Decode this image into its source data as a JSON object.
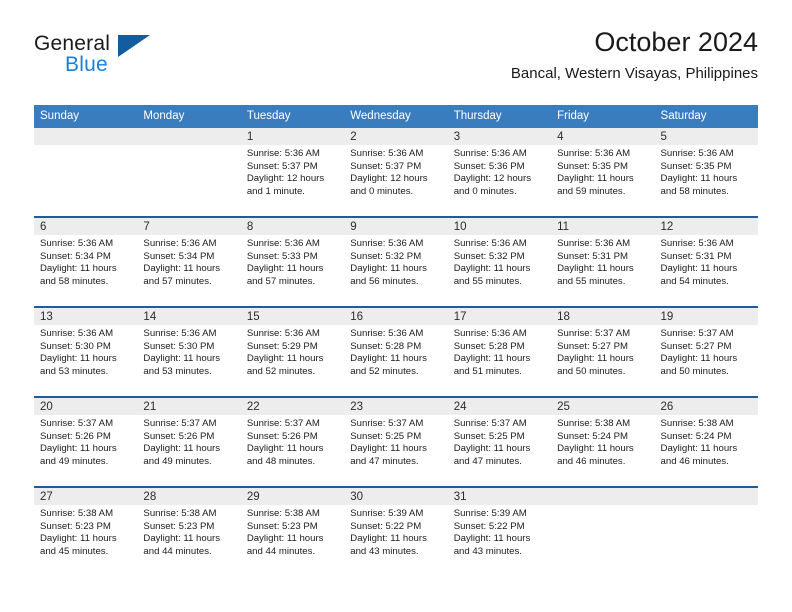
{
  "logo": {
    "word_top": "General",
    "word_bottom": "Blue",
    "triangle_color": "#135ca0",
    "blue_color": "#1b7fd4"
  },
  "header": {
    "title": "October 2024",
    "subtitle": "Bancal, Western Visayas, Philippines"
  },
  "theme": {
    "header_bg": "#3a7dbf",
    "row_divider": "#1f5c9e",
    "day_head_bg": "#ededed"
  },
  "weekdays": [
    "Sunday",
    "Monday",
    "Tuesday",
    "Wednesday",
    "Thursday",
    "Friday",
    "Saturday"
  ],
  "weeks": [
    [
      {
        "date": "",
        "lines": []
      },
      {
        "date": "",
        "lines": []
      },
      {
        "date": "1",
        "lines": [
          "Sunrise: 5:36 AM",
          "Sunset: 5:37 PM",
          "Daylight: 12 hours",
          "and 1 minute."
        ]
      },
      {
        "date": "2",
        "lines": [
          "Sunrise: 5:36 AM",
          "Sunset: 5:37 PM",
          "Daylight: 12 hours",
          "and 0 minutes."
        ]
      },
      {
        "date": "3",
        "lines": [
          "Sunrise: 5:36 AM",
          "Sunset: 5:36 PM",
          "Daylight: 12 hours",
          "and 0 minutes."
        ]
      },
      {
        "date": "4",
        "lines": [
          "Sunrise: 5:36 AM",
          "Sunset: 5:35 PM",
          "Daylight: 11 hours",
          "and 59 minutes."
        ]
      },
      {
        "date": "5",
        "lines": [
          "Sunrise: 5:36 AM",
          "Sunset: 5:35 PM",
          "Daylight: 11 hours",
          "and 58 minutes."
        ]
      }
    ],
    [
      {
        "date": "6",
        "lines": [
          "Sunrise: 5:36 AM",
          "Sunset: 5:34 PM",
          "Daylight: 11 hours",
          "and 58 minutes."
        ]
      },
      {
        "date": "7",
        "lines": [
          "Sunrise: 5:36 AM",
          "Sunset: 5:34 PM",
          "Daylight: 11 hours",
          "and 57 minutes."
        ]
      },
      {
        "date": "8",
        "lines": [
          "Sunrise: 5:36 AM",
          "Sunset: 5:33 PM",
          "Daylight: 11 hours",
          "and 57 minutes."
        ]
      },
      {
        "date": "9",
        "lines": [
          "Sunrise: 5:36 AM",
          "Sunset: 5:32 PM",
          "Daylight: 11 hours",
          "and 56 minutes."
        ]
      },
      {
        "date": "10",
        "lines": [
          "Sunrise: 5:36 AM",
          "Sunset: 5:32 PM",
          "Daylight: 11 hours",
          "and 55 minutes."
        ]
      },
      {
        "date": "11",
        "lines": [
          "Sunrise: 5:36 AM",
          "Sunset: 5:31 PM",
          "Daylight: 11 hours",
          "and 55 minutes."
        ]
      },
      {
        "date": "12",
        "lines": [
          "Sunrise: 5:36 AM",
          "Sunset: 5:31 PM",
          "Daylight: 11 hours",
          "and 54 minutes."
        ]
      }
    ],
    [
      {
        "date": "13",
        "lines": [
          "Sunrise: 5:36 AM",
          "Sunset: 5:30 PM",
          "Daylight: 11 hours",
          "and 53 minutes."
        ]
      },
      {
        "date": "14",
        "lines": [
          "Sunrise: 5:36 AM",
          "Sunset: 5:30 PM",
          "Daylight: 11 hours",
          "and 53 minutes."
        ]
      },
      {
        "date": "15",
        "lines": [
          "Sunrise: 5:36 AM",
          "Sunset: 5:29 PM",
          "Daylight: 11 hours",
          "and 52 minutes."
        ]
      },
      {
        "date": "16",
        "lines": [
          "Sunrise: 5:36 AM",
          "Sunset: 5:28 PM",
          "Daylight: 11 hours",
          "and 52 minutes."
        ]
      },
      {
        "date": "17",
        "lines": [
          "Sunrise: 5:36 AM",
          "Sunset: 5:28 PM",
          "Daylight: 11 hours",
          "and 51 minutes."
        ]
      },
      {
        "date": "18",
        "lines": [
          "Sunrise: 5:37 AM",
          "Sunset: 5:27 PM",
          "Daylight: 11 hours",
          "and 50 minutes."
        ]
      },
      {
        "date": "19",
        "lines": [
          "Sunrise: 5:37 AM",
          "Sunset: 5:27 PM",
          "Daylight: 11 hours",
          "and 50 minutes."
        ]
      }
    ],
    [
      {
        "date": "20",
        "lines": [
          "Sunrise: 5:37 AM",
          "Sunset: 5:26 PM",
          "Daylight: 11 hours",
          "and 49 minutes."
        ]
      },
      {
        "date": "21",
        "lines": [
          "Sunrise: 5:37 AM",
          "Sunset: 5:26 PM",
          "Daylight: 11 hours",
          "and 49 minutes."
        ]
      },
      {
        "date": "22",
        "lines": [
          "Sunrise: 5:37 AM",
          "Sunset: 5:26 PM",
          "Daylight: 11 hours",
          "and 48 minutes."
        ]
      },
      {
        "date": "23",
        "lines": [
          "Sunrise: 5:37 AM",
          "Sunset: 5:25 PM",
          "Daylight: 11 hours",
          "and 47 minutes."
        ]
      },
      {
        "date": "24",
        "lines": [
          "Sunrise: 5:37 AM",
          "Sunset: 5:25 PM",
          "Daylight: 11 hours",
          "and 47 minutes."
        ]
      },
      {
        "date": "25",
        "lines": [
          "Sunrise: 5:38 AM",
          "Sunset: 5:24 PM",
          "Daylight: 11 hours",
          "and 46 minutes."
        ]
      },
      {
        "date": "26",
        "lines": [
          "Sunrise: 5:38 AM",
          "Sunset: 5:24 PM",
          "Daylight: 11 hours",
          "and 46 minutes."
        ]
      }
    ],
    [
      {
        "date": "27",
        "lines": [
          "Sunrise: 5:38 AM",
          "Sunset: 5:23 PM",
          "Daylight: 11 hours",
          "and 45 minutes."
        ]
      },
      {
        "date": "28",
        "lines": [
          "Sunrise: 5:38 AM",
          "Sunset: 5:23 PM",
          "Daylight: 11 hours",
          "and 44 minutes."
        ]
      },
      {
        "date": "29",
        "lines": [
          "Sunrise: 5:38 AM",
          "Sunset: 5:23 PM",
          "Daylight: 11 hours",
          "and 44 minutes."
        ]
      },
      {
        "date": "30",
        "lines": [
          "Sunrise: 5:39 AM",
          "Sunset: 5:22 PM",
          "Daylight: 11 hours",
          "and 43 minutes."
        ]
      },
      {
        "date": "31",
        "lines": [
          "Sunrise: 5:39 AM",
          "Sunset: 5:22 PM",
          "Daylight: 11 hours",
          "and 43 minutes."
        ]
      },
      {
        "date": "",
        "lines": []
      },
      {
        "date": "",
        "lines": []
      }
    ]
  ]
}
